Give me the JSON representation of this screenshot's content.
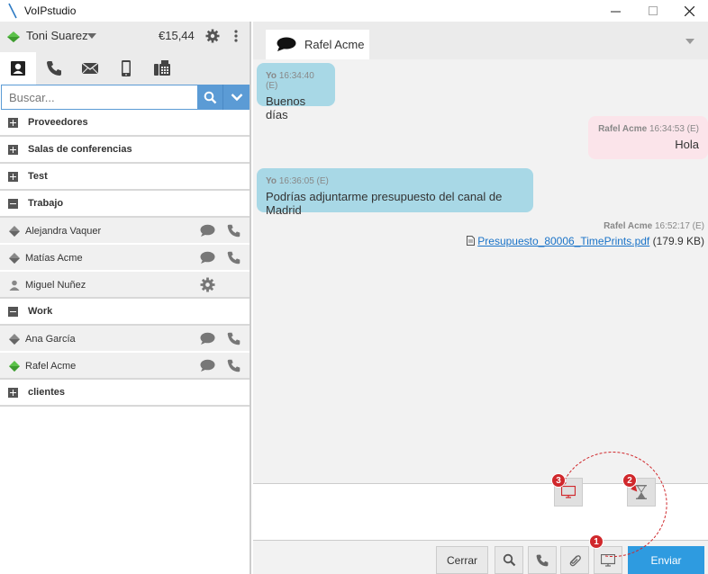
{
  "window": {
    "title": "VoIPstudio",
    "minimize_icon": "minimize-icon",
    "maximize_icon": "maximize-icon",
    "close_icon": "close-icon"
  },
  "user": {
    "name": "Toni Suarez",
    "balance": "€15,44",
    "status_color": "#5cc24a"
  },
  "nav_tabs": [
    {
      "icon": "contacts-icon",
      "active": true
    },
    {
      "icon": "phone-icon"
    },
    {
      "icon": "mail-icon"
    },
    {
      "icon": "mobile-icon"
    },
    {
      "icon": "fax-icon"
    }
  ],
  "search": {
    "placeholder": "Buscar..."
  },
  "contacts": {
    "groups": [
      {
        "label": "Proveedores",
        "expanded": false
      },
      {
        "label": "Salas de conferencias",
        "expanded": false
      },
      {
        "label": "Test",
        "expanded": false
      },
      {
        "label": "Trabajo",
        "expanded": true,
        "members": [
          {
            "name": "Alejandra Vaquer",
            "status": "offline"
          },
          {
            "name": "Matías Acme",
            "status": "offline"
          },
          {
            "name": "Miguel Nuñez",
            "status": "user"
          }
        ]
      },
      {
        "label": "Work",
        "expanded": true,
        "members": [
          {
            "name": "Ana García",
            "status": "offline"
          },
          {
            "name": "Rafel Acme",
            "status": "online"
          }
        ]
      },
      {
        "label": "clientes",
        "expanded": false
      }
    ]
  },
  "chat": {
    "tab_label": "Rafel Acme",
    "messages": [
      {
        "sender": "Yo",
        "time": "16:34:40 (E)",
        "text": "Buenos días"
      },
      {
        "sender": "Rafel Acme",
        "time": "16:34:53 (E)",
        "text": "Hola"
      },
      {
        "sender": "Yo",
        "time": "16:36:05 (E)",
        "text": "Podrías adjuntarme presupuesto del canal de Madrid"
      },
      {
        "sender": "Rafel Acme",
        "time": "16:52:17 (E)",
        "file_name": "Presupuesto_80006_TimePrints.pdf",
        "file_size": "(179.9 KB)"
      }
    ]
  },
  "actions": {
    "close_label": "Cerrar",
    "send_label": "Enviar"
  },
  "annotations": [
    "1",
    "2",
    "3"
  ],
  "colors": {
    "accent": "#5b9bd5",
    "send": "#2e9be0",
    "my_bubble": "#a8d8e6",
    "their_bubble": "#fbe4ea",
    "badge": "#d0282c"
  }
}
